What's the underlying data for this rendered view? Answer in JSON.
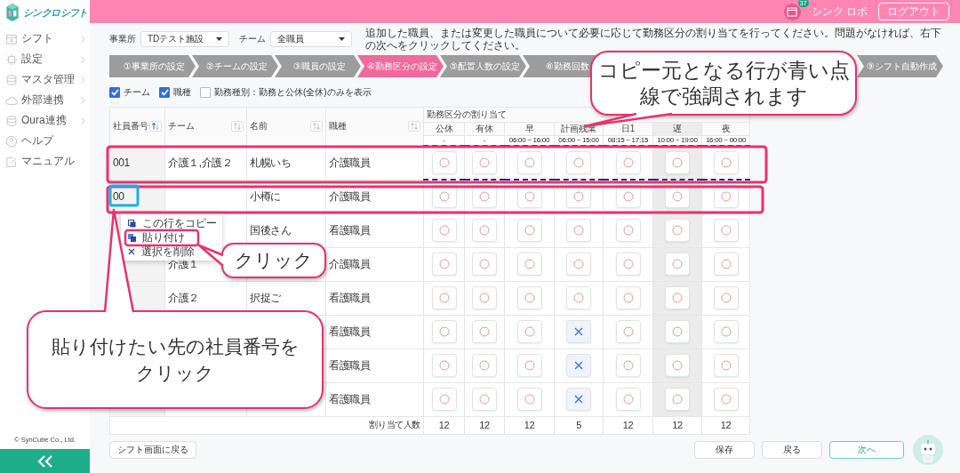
{
  "sidebar": {
    "logo": "シンクロシフト",
    "items": [
      {
        "label": "シフト",
        "submenu": true
      },
      {
        "label": "設定",
        "submenu": true
      },
      {
        "label": "マスタ管理",
        "submenu": true
      },
      {
        "label": "外部連携",
        "submenu": true
      },
      {
        "label": "Oura連携",
        "submenu": true
      },
      {
        "label": "ヘルプ",
        "submenu": false
      },
      {
        "label": "マニュアル",
        "submenu": false
      }
    ],
    "copyright": "© SynCube Co., Ltd."
  },
  "header": {
    "badge": "37",
    "user": "シンク ロボ",
    "logout": "ログアウト"
  },
  "filters": [
    {
      "label": "事業所",
      "value": "TDテスト施設"
    },
    {
      "label": "チーム",
      "value": "全職員"
    }
  ],
  "instruction": "追加した職員、または変更した職員について必要に応じて勤務区分の割り当てを行ってください。問題がなければ、右下の次へをクリックしてください。",
  "steps": [
    {
      "label": "①事業所の設定",
      "selected": false
    },
    {
      "label": "②チームの設定",
      "selected": false
    },
    {
      "label": "③職員の設定",
      "selected": false
    },
    {
      "label": "④勤務区分の設定",
      "selected": true
    },
    {
      "label": "⑤配置人数の設定",
      "selected": false
    },
    {
      "label": "⑥勤務回数",
      "selected": false
    },
    {
      "label": "⑨シフト自動作成",
      "selected": false
    }
  ],
  "display_options": [
    {
      "label": "チーム",
      "checked": true
    },
    {
      "label": "職種",
      "checked": true
    },
    {
      "label": "勤務種別：勤務と公休(全休)のみを表示",
      "checked": false
    }
  ],
  "table": {
    "columns": [
      {
        "label": "社員番号",
        "sorted": true
      },
      {
        "label": "チーム",
        "sorted": false
      },
      {
        "label": "名前",
        "sorted": false
      },
      {
        "label": "職種",
        "sorted": false
      }
    ],
    "group_label": "勤務区分の割り当て",
    "shifts": [
      {
        "name": "公休",
        "time": "-",
        "highlighted": false
      },
      {
        "name": "有休",
        "time": "-",
        "highlighted": false
      },
      {
        "name": "早",
        "time": "06:00 ~ 16:00",
        "highlighted": false
      },
      {
        "name": "計画残業",
        "time": "06:00 ~ 15:00",
        "highlighted": false
      },
      {
        "name": "日1",
        "time": "08:15 ~ 17:15",
        "highlighted": false
      },
      {
        "name": "遅",
        "time": "10:00 ~ 19:00",
        "highlighted": true
      },
      {
        "name": "夜",
        "time": "16:00 ~ 00:00",
        "highlighted": false
      }
    ],
    "rows": [
      {
        "employee_no": "001",
        "team": "介護１,介護２",
        "name": "札幌いち",
        "job": "介護職員",
        "copy_source": true,
        "cells": [
          true,
          true,
          true,
          true,
          true,
          true,
          true
        ]
      },
      {
        "employee_no": "00",
        "name": "小樽に",
        "job": "介護職員",
        "copy_source": false,
        "cells": [
          true,
          true,
          true,
          true,
          true,
          true,
          true
        ]
      },
      {
        "name": "国後さん",
        "job": "看護職員",
        "copy_source": false,
        "cells": [
          true,
          true,
          true,
          true,
          true,
          true,
          true
        ]
      },
      {
        "team": "介護１",
        "job": "介護職員",
        "copy_source": false,
        "cells": [
          true,
          true,
          true,
          true,
          true,
          true,
          true
        ]
      },
      {
        "team": "介護２",
        "name": "択捉ご",
        "job": "看護職員",
        "copy_source": false,
        "cells": [
          true,
          true,
          true,
          true,
          true,
          true,
          true
        ]
      },
      {
        "job": "看護職員",
        "copy_source": false,
        "cells": [
          true,
          true,
          true,
          false,
          true,
          true,
          true
        ]
      },
      {
        "job": "看護職員",
        "copy_source": false,
        "cells": [
          true,
          true,
          true,
          false,
          true,
          true,
          true
        ]
      },
      {
        "job": "看護職員",
        "copy_source": false,
        "cells": [
          true,
          true,
          true,
          false,
          true,
          true,
          true
        ]
      }
    ],
    "totals": {
      "label": "割り当て人数",
      "values": [
        "12",
        "12",
        "12",
        "5",
        "12",
        "12",
        "12"
      ]
    }
  },
  "context_menu": [
    {
      "label": "この行をコピー",
      "kind": "copy"
    },
    {
      "label": "貼り付け",
      "kind": "paste"
    },
    {
      "label": "選択を削除",
      "kind": "delete"
    }
  ],
  "footer": {
    "back": "シフト画面に戻る",
    "buttons": [
      {
        "label": "保存",
        "kind": "plain"
      },
      {
        "label": "戻る",
        "kind": "plain"
      },
      {
        "label": "次へ",
        "kind": "primary"
      }
    ]
  },
  "callouts": [
    {
      "lines": [
        "コピー元となる行が青い点",
        "線で強調されます"
      ]
    },
    {
      "lines": [
        "クリック"
      ]
    },
    {
      "lines": [
        "貼り付けたい先の社員番号を",
        "クリック"
      ]
    }
  ]
}
